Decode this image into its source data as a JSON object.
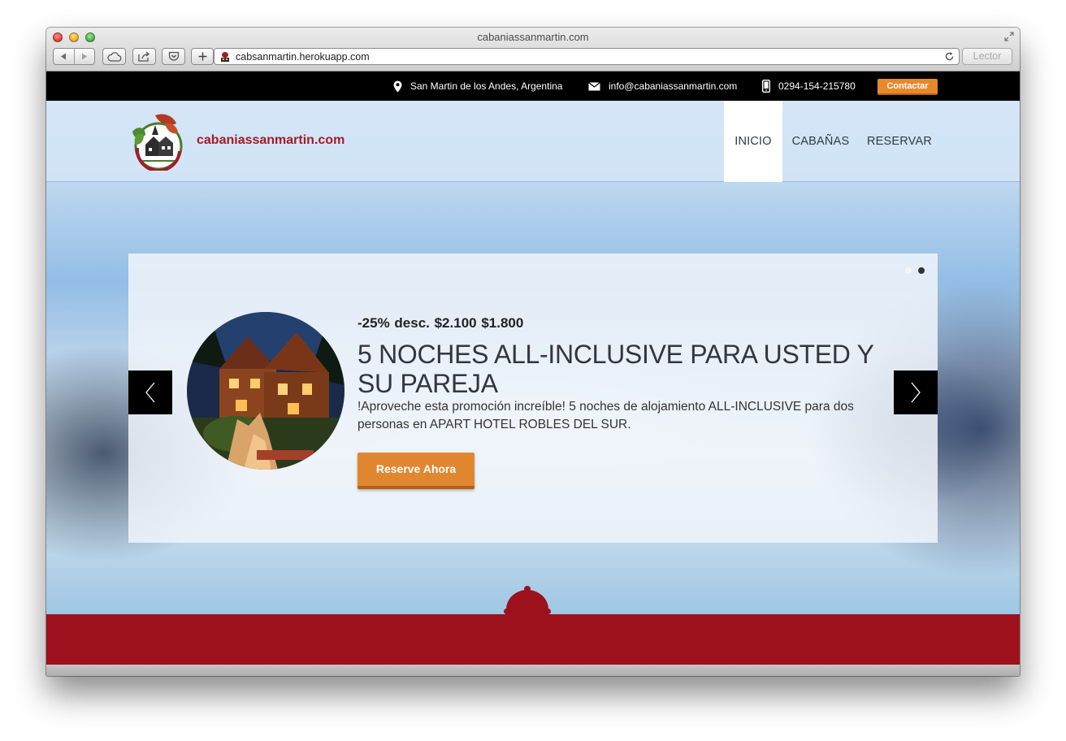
{
  "window": {
    "title": "cabaniassanmartin.com",
    "url": "cabsanmartin.herokuapp.com",
    "reader_label": "Lector"
  },
  "topbar": {
    "location": "San Martin de los Andes, Argentina",
    "email": "info@cabaniassanmartin.com",
    "phone": "0294-154-215780",
    "contact_label": "Contactar"
  },
  "header": {
    "logo_text": "cabaniassanmartin.com",
    "nav": [
      {
        "label": "INICIO",
        "active": true
      },
      {
        "label": "CABAÑAS",
        "active": false
      },
      {
        "label": "RESERVAR",
        "active": false
      }
    ]
  },
  "slider": {
    "price_line": "-25% desc. $2.100   $1.800",
    "title": "5 NOCHES ALL-INCLUSIVE PARA USTED Y SU PAREJA",
    "description": "!Aproveche esta promoción increíble! 5 noches de alojamiento ALL-INCLUSIVE para dos personas en APART HOTEL ROBLES DEL SUR.",
    "cta_label": "Reserve Ahora",
    "active_dot": 2,
    "dots": 2
  },
  "colors": {
    "brand_red": "#9d111d",
    "accent_orange": "#e0872f",
    "topbar_bg": "#000000"
  },
  "icons": {
    "location": "map-pin-icon",
    "email": "envelope-icon",
    "phone": "mobile-phone-icon",
    "section": "cloche-icon"
  }
}
